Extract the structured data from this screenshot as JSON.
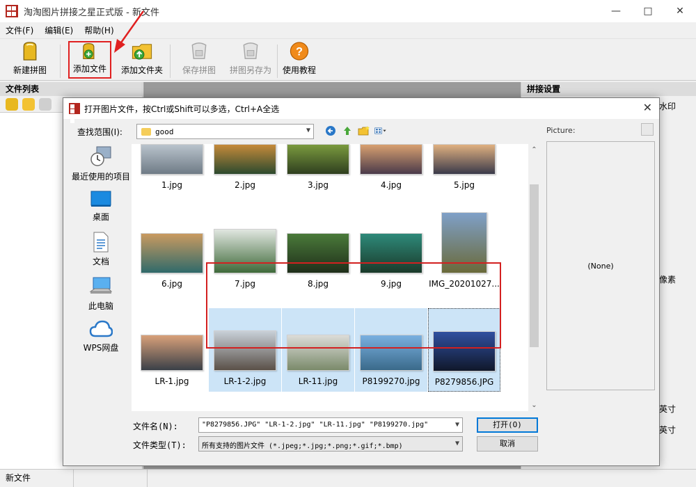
{
  "window": {
    "title": "淘淘图片拼接之星正式版 - 新文件"
  },
  "menu": [
    "文件(F)",
    "编辑(E)",
    "帮助(H)"
  ],
  "toolbar": {
    "new": "新建拼图",
    "add_file": "添加文件",
    "add_folder": "添加文件夹",
    "save": "保存拼图",
    "save_as": "拼图另存为",
    "tutorial": "使用教程"
  },
  "left_panel": {
    "title": "文件列表"
  },
  "right_panel": {
    "title": "拼接设置",
    "frag1": "水印",
    "frag2": "像素",
    "frag3": "/英寸",
    "frag4": "/英寸"
  },
  "status": {
    "text": "新文件"
  },
  "dialog": {
    "title": "打开图片文件，按Ctrl或Shift可以多选，Ctrl+A全选",
    "look_in_label": "查找范围(I):",
    "look_in_value": "good",
    "places": [
      "最近使用的项目",
      "桌面",
      "文档",
      "此电脑",
      "WPS网盘"
    ],
    "preview_label": "Picture:",
    "preview_value": "(None)",
    "filename_label": "文件名(N):",
    "filename_value": "\"P8279856.JPG\" \"LR-1-2.jpg\" \"LR-11.jpg\" \"P8199270.jpg\"",
    "filetype_label": "文件类型(T):",
    "filetype_value": "所有支持的图片文件 (*.jpeg;*.jpg;*.png;*.gif;*.bmp)",
    "open_button": "打开(O)",
    "cancel_button": "取消",
    "files": [
      {
        "name": "1.jpg",
        "colors": [
          "#b9c3cc",
          "#6f7b86"
        ]
      },
      {
        "name": "2.jpg",
        "colors": [
          "#c58a3a",
          "#2c4a2e"
        ]
      },
      {
        "name": "3.jpg",
        "colors": [
          "#7a9a3e",
          "#2f3f1f"
        ]
      },
      {
        "name": "4.jpg",
        "colors": [
          "#d8a070",
          "#4a3a4a"
        ]
      },
      {
        "name": "5.jpg",
        "colors": [
          "#e0b080",
          "#3a3a4a"
        ]
      },
      {
        "name": "6.jpg",
        "colors": [
          "#c99a60",
          "#2f6a6a"
        ]
      },
      {
        "name": "7.jpg",
        "colors": [
          "#e0e6e0",
          "#3f6a3a"
        ]
      },
      {
        "name": "8.jpg",
        "colors": [
          "#4a7a3a",
          "#1f2f1a"
        ]
      },
      {
        "name": "9.jpg",
        "colors": [
          "#2e8a7a",
          "#1a3a2a"
        ]
      },
      {
        "name": "IMG_20201027...",
        "colors": [
          "#7fa0c8",
          "#6a6a3a"
        ]
      },
      {
        "name": "LR-1.jpg",
        "colors": [
          "#d8a07a",
          "#3a4048"
        ]
      },
      {
        "name": "LR-1-2.jpg",
        "colors": [
          "#c8d0d8",
          "#5a5048"
        ]
      },
      {
        "name": "LR-11.jpg",
        "colors": [
          "#dcdcd8",
          "#7a8a6a"
        ]
      },
      {
        "name": "P8199270.jpg",
        "colors": [
          "#7ab0e0",
          "#3a6a8a"
        ]
      },
      {
        "name": "P8279856.JPG",
        "colors": [
          "#3050a0",
          "#10182a"
        ]
      }
    ]
  }
}
